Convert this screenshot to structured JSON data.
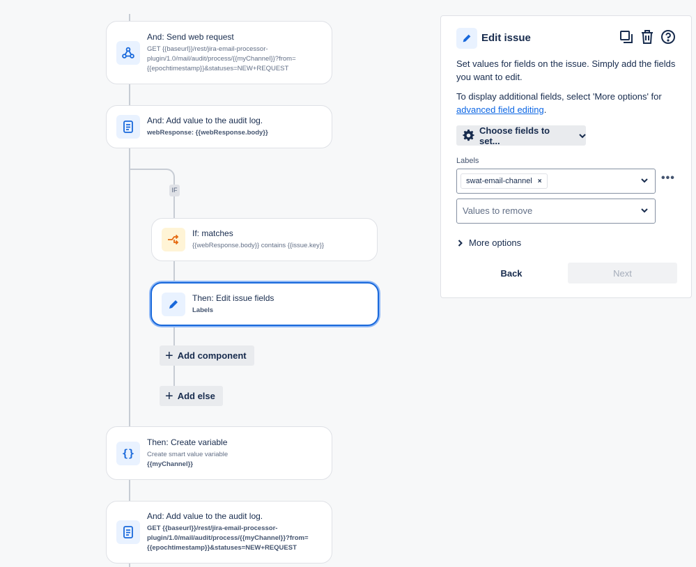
{
  "flow": {
    "send_request": {
      "title": "And: Send web request",
      "detail": "GET {{baseurl}}/rest/jira-email-processor-plugin/1.0/mail/audit/process/{{myChannel}}?from={{epochtimestamp}}&statuses=NEW+REQUEST"
    },
    "audit_log_1": {
      "title": "And: Add value to the audit log.",
      "detail": "webResponse: {{webResponse.body}}"
    },
    "if_tag": "IF",
    "if_matches": {
      "title": "If: matches",
      "detail": "{{webResponse.body}} contains {{issue.key}}"
    },
    "edit_fields": {
      "title": "Then: Edit issue fields",
      "detail": "Labels"
    },
    "add_component": "Add component",
    "add_else": "Add else",
    "create_variable": {
      "title": "Then: Create variable",
      "detail": "Create smart value variable",
      "detail2": "{{myChannel}}"
    },
    "audit_log_2": {
      "title": "And: Add value to the audit log.",
      "detail": "GET {{baseurl}}/rest/jira-email-processor-plugin/1.0/mail/audit/process/{{myChannel}}?from={{epochtimestamp}}&statuses=NEW+REQUEST"
    }
  },
  "panel": {
    "title": "Edit issue",
    "description": "Set values for fields on the issue. Simply add the fields you want to edit.",
    "more_text": "To display additional fields, select 'More options' for",
    "link": "advanced field editing",
    "period": ".",
    "choose_fields": "Choose fields to set...",
    "labels_label": "Labels",
    "labels_chip": "swat-email-channel",
    "chip_remove": "×",
    "remove_placeholder": "Values to remove",
    "more_options": "More options",
    "back": "Back",
    "next": "Next",
    "dots": "•••"
  },
  "colors": {
    "accent": "#1868db",
    "link": "#0c66e4",
    "icon_blue": "#1868db",
    "icon_orange": "#e56910"
  }
}
